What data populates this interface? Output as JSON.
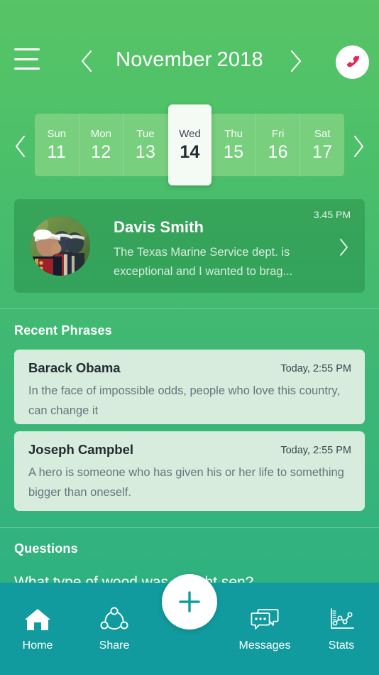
{
  "header": {
    "menu_icon": "hamburger-menu-icon",
    "prev_icon": "chevron-left-icon",
    "next_icon": "chevron-right-icon",
    "month": "November",
    "year": "2018",
    "call_icon": "phone-handset-icon",
    "call_icon_color": "#e8275a"
  },
  "date_strip": {
    "prev_icon": "chevron-left-icon",
    "next_icon": "chevron-right-icon",
    "selected_index": 3,
    "days": [
      {
        "weekday": "Sun",
        "date": "11"
      },
      {
        "weekday": "Mon",
        "date": "12"
      },
      {
        "weekday": "Tue",
        "date": "13"
      },
      {
        "weekday": "Wed",
        "date": "14"
      },
      {
        "weekday": "Thu",
        "date": "15"
      },
      {
        "weekday": "Fri",
        "date": "16"
      },
      {
        "weekday": "Sat",
        "date": "17"
      }
    ]
  },
  "featured_message": {
    "avatar_icon": "marine-salute-avatar",
    "name": "Davis Smith",
    "preview": "The Texas Marine Service dept. is exceptional and I wanted to brag...",
    "time": "3.45 PM",
    "arrow_icon": "chevron-right-icon"
  },
  "recent_phrases": {
    "title": "Recent Phrases",
    "items": [
      {
        "author": "Barack Obama",
        "time": "Today, 2:55 PM",
        "quote": "In the face of impossible odds, people who love this country, can change it"
      },
      {
        "author": "Joseph Campbel",
        "time": "Today, 2:55 PM",
        "quote": "A hero is someone who has given his or her life to something  bigger than oneself."
      }
    ]
  },
  "questions": {
    "title": "Questions",
    "items": [
      {
        "text": "What type of wood was a night sen?"
      }
    ]
  },
  "bottom_nav": {
    "background": "#119b9e",
    "items": [
      {
        "label": "Home",
        "icon": "home-icon",
        "active": true
      },
      {
        "label": "Share",
        "icon": "share-nodes-icon",
        "active": false
      },
      {
        "label": "Messages",
        "icon": "chat-bubbles-icon",
        "active": false
      },
      {
        "label": "Stats",
        "icon": "line-chart-icon",
        "active": false
      }
    ],
    "fab": {
      "icon": "plus-icon",
      "color": "#119b9e"
    }
  },
  "theme": {
    "gradient_top": "#57c466",
    "gradient_bottom": "#2bb183",
    "phrase_card_bg": "#d7ecdd",
    "accent_teal": "#119b9e",
    "accent_pink": "#e8275a"
  }
}
